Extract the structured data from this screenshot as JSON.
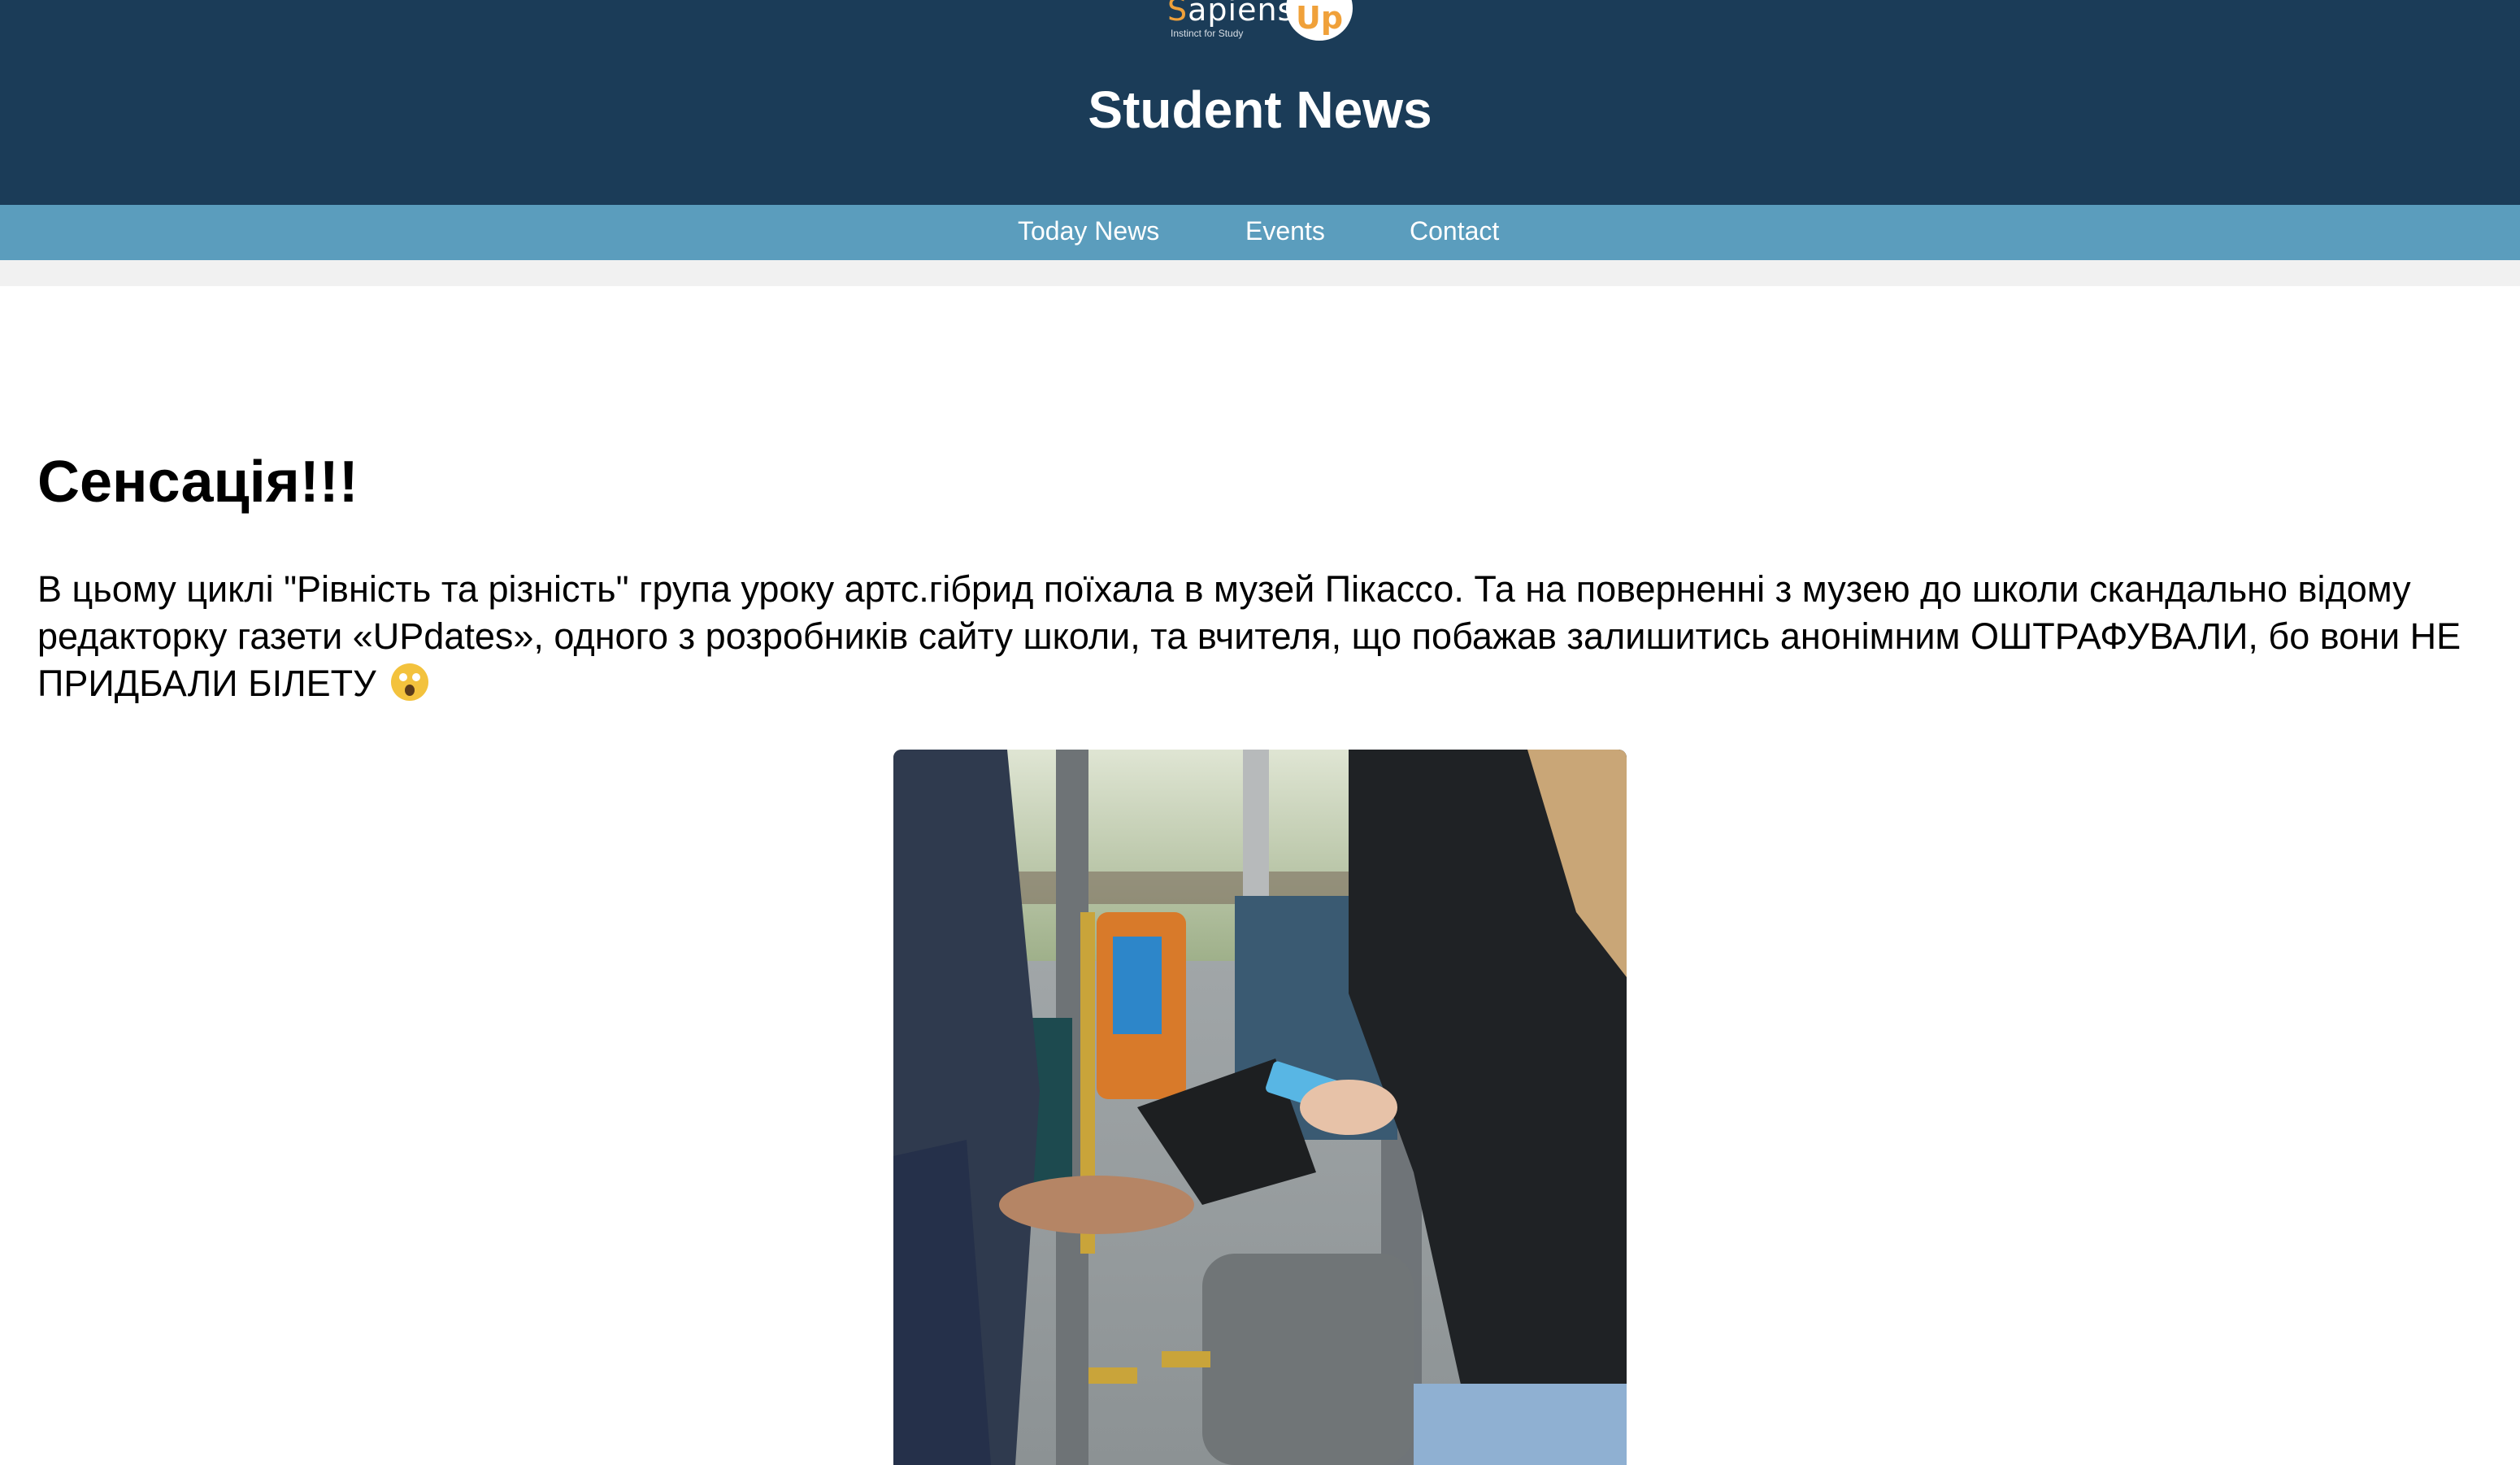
{
  "header": {
    "logo": {
      "first_letter": "S",
      "name_rest": "apiens",
      "badge": "Up",
      "tagline": "Instinct for Study"
    },
    "site_title": "Student News"
  },
  "nav": {
    "items": [
      {
        "label": "Today News"
      },
      {
        "label": "Events"
      },
      {
        "label": "Contact"
      }
    ]
  },
  "article": {
    "title": "Сенсація!!!",
    "body": "В цьому циклі \"Рівність та різність\" група уроку артс.гібрид поїхала в музей Пікассо. Та на поверненні з музею до школи скандально відому редакторку газети «UPdates», одного з розробників сайту школи, та вчителя, що побажав залишитись анонімним ОШТРАФУВАЛИ, бо вони НЕ ПРИДБАЛИ БІЛЕТУ",
    "emoji_icon": "screaming-face-emoji"
  },
  "colors": {
    "header_bg": "#1b3c58",
    "nav_bg": "#5b9dbd",
    "logo_accent": "#f0a13a"
  }
}
